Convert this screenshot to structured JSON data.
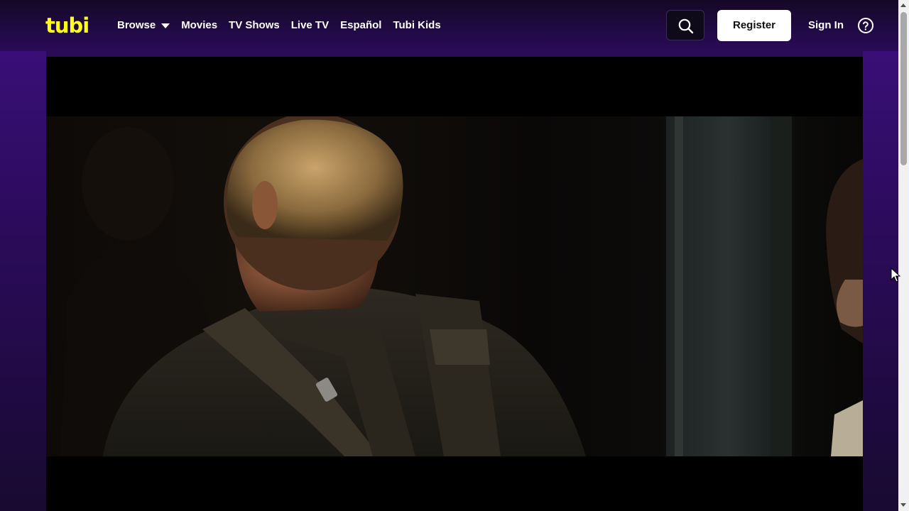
{
  "header": {
    "logo_text": "tubi",
    "nav": [
      {
        "label": "Browse",
        "has_dropdown": true
      },
      {
        "label": "Movies"
      },
      {
        "label": "TV Shows"
      },
      {
        "label": "Live TV"
      },
      {
        "label": "Español"
      },
      {
        "label": "Tubi Kids"
      }
    ],
    "register_label": "Register",
    "signin_label": "Sign In"
  },
  "icons": {
    "search": "search-icon",
    "help": "help-circle-icon",
    "dropdown": "caret-down-icon"
  },
  "colors": {
    "brand_yellow": "#ffff13",
    "background_purple": "#2a0c57"
  }
}
